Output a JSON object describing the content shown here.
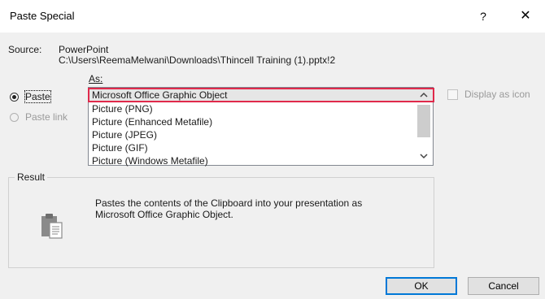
{
  "window": {
    "title": "Paste Special",
    "help_label": "?",
    "close_label": "✕"
  },
  "source": {
    "label": "Source:",
    "app": "PowerPoint",
    "path": "C:\\Users\\ReemaMelwani\\Downloads\\Thincell Training (1).pptx!2"
  },
  "options": {
    "paste_label": "Paste",
    "paste_link_label": "Paste link",
    "paste_selected": true,
    "paste_link_enabled": false
  },
  "as": {
    "label": "As:",
    "items": [
      "Microsoft Office Graphic Object",
      "Picture (PNG)",
      "Picture (Enhanced Metafile)",
      "Picture (JPEG)",
      "Picture (GIF)",
      "Picture (Windows Metafile)"
    ],
    "selected_index": 0
  },
  "display_as_icon": {
    "label": "Display as icon",
    "checked": false,
    "enabled": false
  },
  "result": {
    "legend": "Result",
    "line1": "Pastes the contents of the Clipboard into your presentation as",
    "line2": "Microsoft Office Graphic Object."
  },
  "buttons": {
    "ok_label": "OK",
    "cancel_label": "Cancel"
  },
  "colors": {
    "selection_outline": "#e0294b",
    "default_button_border": "#0078d7"
  },
  "icons": {
    "up": "chevron-up-icon",
    "down": "chevron-down-icon",
    "clipboard": "clipboard-icon"
  }
}
